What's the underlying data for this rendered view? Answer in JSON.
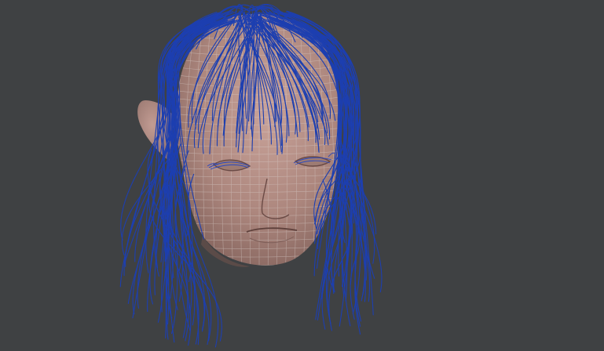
{
  "viewport": {
    "background_color": "#3f4143",
    "mesh_wire_color": "#d7ccc8",
    "hair_curve_color": "#1d3fb0",
    "skin_color": "#b89289"
  },
  "scene": {
    "object": "head-mesh",
    "shading": "solid-with-wireframe",
    "hair_display": "guide-curves"
  }
}
